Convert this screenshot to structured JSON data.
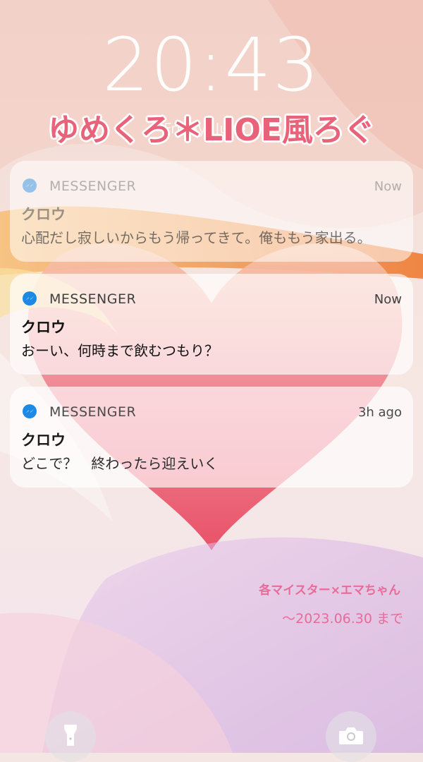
{
  "lockscreen": {
    "time": "20:43",
    "date": "Friday, June 2"
  },
  "overlay": {
    "title": "ゆめくろ＊LIOE風ろぐ",
    "credit": "各マイスター×エマちゃん",
    "deadline": "～2023.06.30 まで"
  },
  "notifications": [
    {
      "app": "MESSENGER",
      "time": "Now",
      "sender": "クロウ",
      "body": "心配だし寂しいからもう帰ってきて。俺ももう家出る。"
    },
    {
      "app": "MESSENGER",
      "time": "Now",
      "sender": "クロウ",
      "body": "おーい、何時まで飲むつもり？"
    },
    {
      "app": "MESSENGER",
      "time": "3h ago",
      "sender": "クロウ",
      "body": "どこで？　終わったら迎えいく"
    }
  ],
  "buttons": {
    "flashlight_icon": "flashlight-icon",
    "camera_icon": "camera-icon"
  },
  "colors": {
    "accent_pink": "#e8627a",
    "credit_pink": "#e86b9a",
    "messenger_blue": "#1e88e5"
  }
}
